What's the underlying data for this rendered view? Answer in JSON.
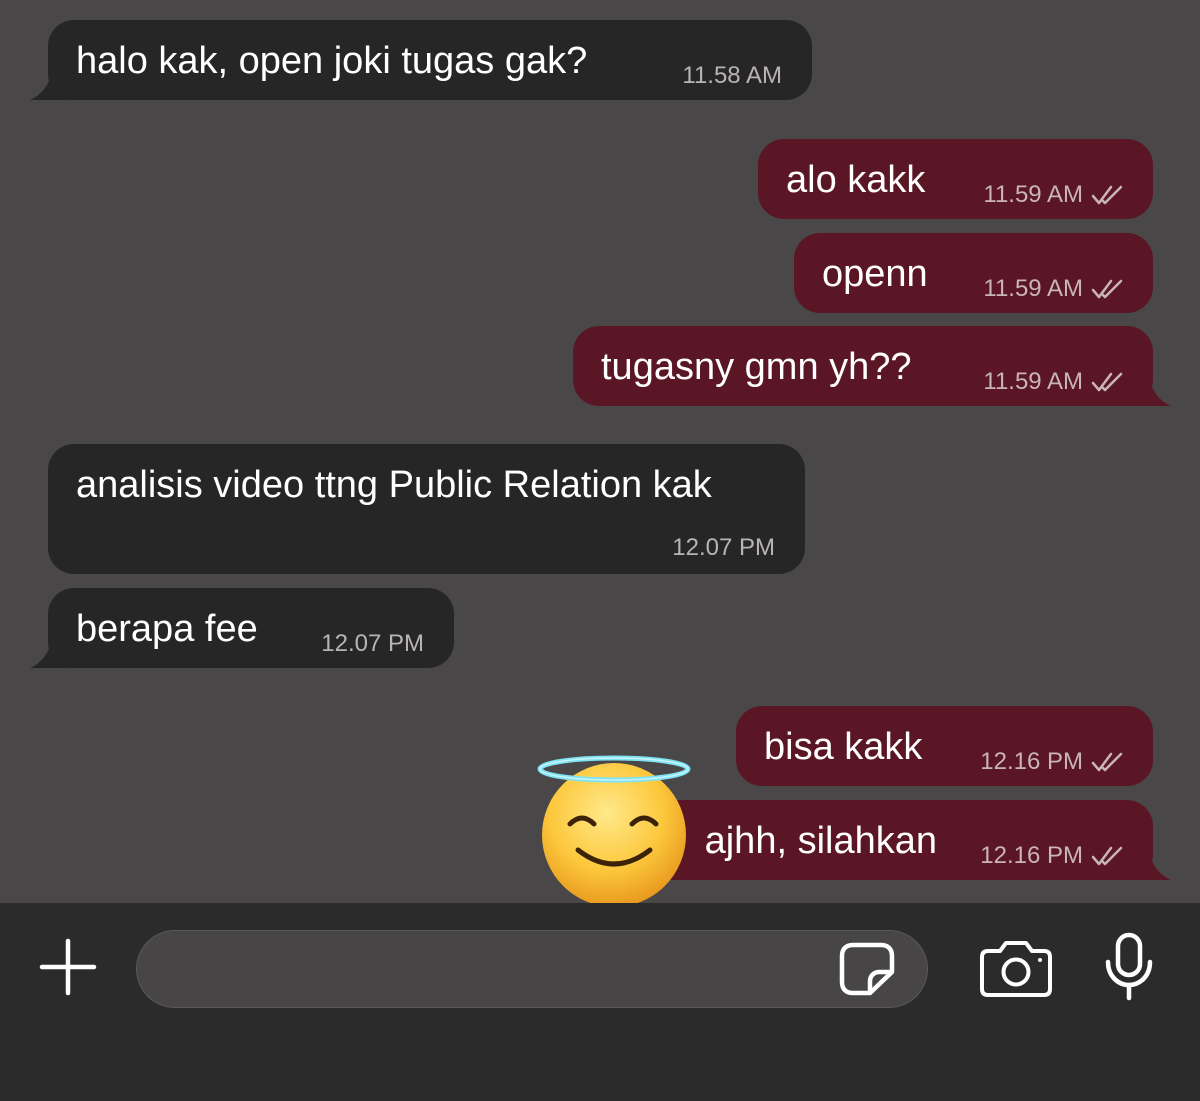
{
  "messages": [
    {
      "direction": "incoming",
      "text": "halo kak, open joki tugas gak?",
      "time": "11.58 AM"
    },
    {
      "direction": "outgoing",
      "text": "alo kakk",
      "time": "11.59 AM",
      "status": "read-ticks"
    },
    {
      "direction": "outgoing",
      "text": "openn",
      "time": "11.59 AM",
      "status": "read-ticks"
    },
    {
      "direction": "outgoing",
      "text": "tugasny gmn yh??",
      "time": "11.59 AM",
      "status": "read-ticks"
    },
    {
      "direction": "incoming",
      "text": "analisis video ttng Public Relation kak",
      "time": "12.07 PM"
    },
    {
      "direction": "incoming",
      "text": "berapa fee",
      "time": "12.07 PM"
    },
    {
      "direction": "outgoing",
      "text": "bisa kakk",
      "time": "12.16 PM",
      "status": "read-ticks"
    },
    {
      "direction": "outgoing",
      "text": "ajhh, silahkan",
      "time": "12.16 PM",
      "status": "read-ticks"
    }
  ],
  "composer": {
    "placeholder": "",
    "icons": [
      "plus-icon",
      "sticker-icon",
      "camera-icon",
      "microphone-icon"
    ]
  },
  "overlay": {
    "icon": "smiling-face-with-halo-emoji"
  },
  "colors": {
    "background": "#4a4748",
    "incoming_bubble": "#262627",
    "outgoing_bubble": "#5a1624",
    "composer_bar": "#2c2b2c"
  }
}
